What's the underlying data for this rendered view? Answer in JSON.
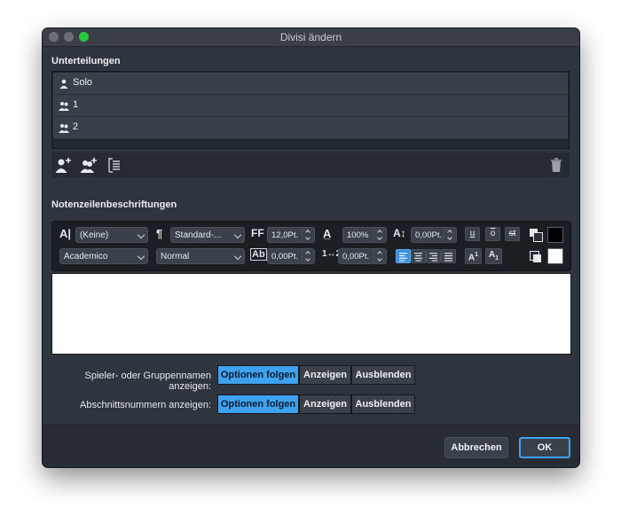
{
  "window": {
    "title": "Divisi ändern"
  },
  "divisions": {
    "heading": "Unterteilungen",
    "items": [
      {
        "label": "Solo",
        "icon": "single-person-icon"
      },
      {
        "label": "1",
        "icon": "two-person-icon"
      },
      {
        "label": "2",
        "icon": "two-person-icon"
      }
    ],
    "toolbar": [
      "add-player-icon",
      "add-group-icon",
      "staff-list-icon",
      "trash-icon"
    ]
  },
  "labels": {
    "heading": "Notenzeilenbeschriftungen",
    "format": {
      "char_style": "(Keine)",
      "para_style": "Standard-...",
      "font": "Academico",
      "weight": "Normal",
      "size": "12,0Pt.",
      "scale": "100%",
      "baseline": "0,00Pt.",
      "tracking": "0,00Pt.",
      "spacing": "0,00Pt.",
      "underline": "u",
      "overline": "o",
      "strike": "st",
      "superscript": "A",
      "superscript_mark": "1",
      "subscript": "A",
      "subscript_mark": "1",
      "fg_color": "#000000",
      "bg_color": "#ffffff"
    }
  },
  "options": {
    "player_names": {
      "label": "Spieler- oder Gruppennamen anzeigen:",
      "choices": [
        "Optionen folgen",
        "Anzeigen",
        "Ausblenden"
      ],
      "selected": "Optionen folgen"
    },
    "section_numbers": {
      "label": "Abschnittsnummern anzeigen:",
      "choices": [
        "Optionen folgen",
        "Anzeigen",
        "Ausblenden"
      ],
      "selected": "Optionen folgen"
    }
  },
  "buttons": {
    "cancel": "Abbrechen",
    "ok": "OK"
  },
  "colors": {
    "accent": "#3ea2f0",
    "window_bg": "#2f353f"
  }
}
